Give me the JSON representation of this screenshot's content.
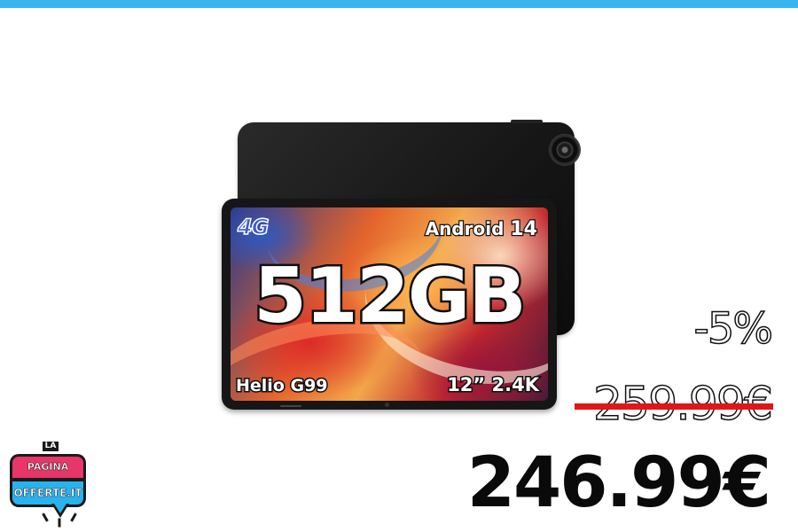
{
  "colors": {
    "top_bar": "#39b4ee",
    "strike_line": "#e21616",
    "logo_pink": "#e8356a",
    "logo_blue": "#28b3ee"
  },
  "product": {
    "network_badge": "4G",
    "os_name": "Android",
    "os_version": "14",
    "storage": "512GB",
    "processor": "Helio G99",
    "display": "12” 2.4K",
    "icons": [
      "camera-icon"
    ]
  },
  "pricing": {
    "discount": "-5%",
    "original_price": "259.99€",
    "current_price": "246.99€"
  },
  "logo": {
    "prefix": "LA",
    "line1": "PAGINA DELLE",
    "line2": "OFFERTE.IT"
  }
}
